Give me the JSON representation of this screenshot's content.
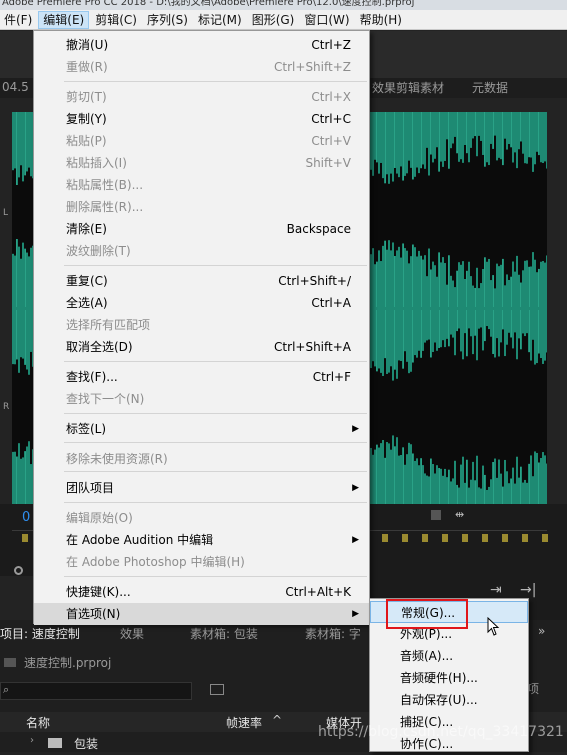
{
  "title_bar": {
    "text": "Adobe Premiere Pro CC 2018 - D:\\我的文档\\Adobe\\Premiere Pro\\12.0\\速度控制.prproj"
  },
  "menubar": {
    "items": [
      "件(F)",
      "编辑(E)",
      "剪辑(C)",
      "序列(S)",
      "标记(M)",
      "图形(G)",
      "窗口(W)",
      "帮助(H)"
    ]
  },
  "app": {
    "time_left": "04.5",
    "tab_draft": "效果剪辑素材",
    "tab_metadata": "元数据",
    "timecode_zero": "0",
    "channel_l": "L",
    "channel_r": "R",
    "project_tab": "项目: 速度控制",
    "effects_tab": "效果",
    "bin_tab": "素材箱: 包装",
    "bin_tab2": "素材箱: 字",
    "project_file": "速度控制.prproj",
    "col_name": "名称",
    "col_fps": "帧速率",
    "col_media": "媒体开",
    "folder_name": "包装",
    "right_label": "项"
  },
  "edit_menu": {
    "items": [
      {
        "label": "撤消(U)",
        "shortcut": "Ctrl+Z",
        "disabled": false
      },
      {
        "label": "重做(R)",
        "shortcut": "Ctrl+Shift+Z",
        "disabled": true
      },
      {
        "label": "剪切(T)",
        "shortcut": "Ctrl+X",
        "disabled": true
      },
      {
        "label": "复制(Y)",
        "shortcut": "Ctrl+C",
        "disabled": false
      },
      {
        "label": "粘贴(P)",
        "shortcut": "Ctrl+V",
        "disabled": true
      },
      {
        "label": "粘贴插入(I)",
        "shortcut": "Shift+V",
        "disabled": true
      },
      {
        "label": "粘贴属性(B)...",
        "shortcut": "",
        "disabled": true
      },
      {
        "label": "删除属性(R)...",
        "shortcut": "",
        "disabled": true
      },
      {
        "label": "清除(E)",
        "shortcut": "Backspace",
        "disabled": false
      },
      {
        "label": "波纹删除(T)",
        "shortcut": "",
        "disabled": true
      },
      {
        "label": "重复(C)",
        "shortcut": "Ctrl+Shift+/",
        "disabled": false
      },
      {
        "label": "全选(A)",
        "shortcut": "Ctrl+A",
        "disabled": false
      },
      {
        "label": "选择所有匹配项",
        "shortcut": "",
        "disabled": true
      },
      {
        "label": "取消全选(D)",
        "shortcut": "Ctrl+Shift+A",
        "disabled": false
      },
      {
        "label": "查找(F)...",
        "shortcut": "Ctrl+F",
        "disabled": false
      },
      {
        "label": "查找下一个(N)",
        "shortcut": "",
        "disabled": true
      },
      {
        "label": "标签(L)",
        "shortcut": "",
        "disabled": false
      },
      {
        "label": "移除未使用资源(R)",
        "shortcut": "",
        "disabled": true
      },
      {
        "label": "团队项目",
        "shortcut": "",
        "disabled": false
      },
      {
        "label": "编辑原始(O)",
        "shortcut": "",
        "disabled": true
      },
      {
        "label": "在 Adobe Audition 中编辑",
        "shortcut": "",
        "disabled": false
      },
      {
        "label": "在 Adobe Photoshop 中编辑(H)",
        "shortcut": "",
        "disabled": true
      },
      {
        "label": "快捷键(K)...",
        "shortcut": "Ctrl+Alt+K",
        "disabled": false
      },
      {
        "label": "首选项(N)",
        "shortcut": "",
        "disabled": false
      }
    ]
  },
  "preferences_submenu": {
    "items": [
      "常规(G)...",
      "外观(P)...",
      "音频(A)...",
      "音频硬件(H)...",
      "自动保存(U)...",
      "捕捉(C)...",
      "协作(C)..."
    ]
  },
  "watermark": "https://blog.csdn.net/qq_33417321"
}
